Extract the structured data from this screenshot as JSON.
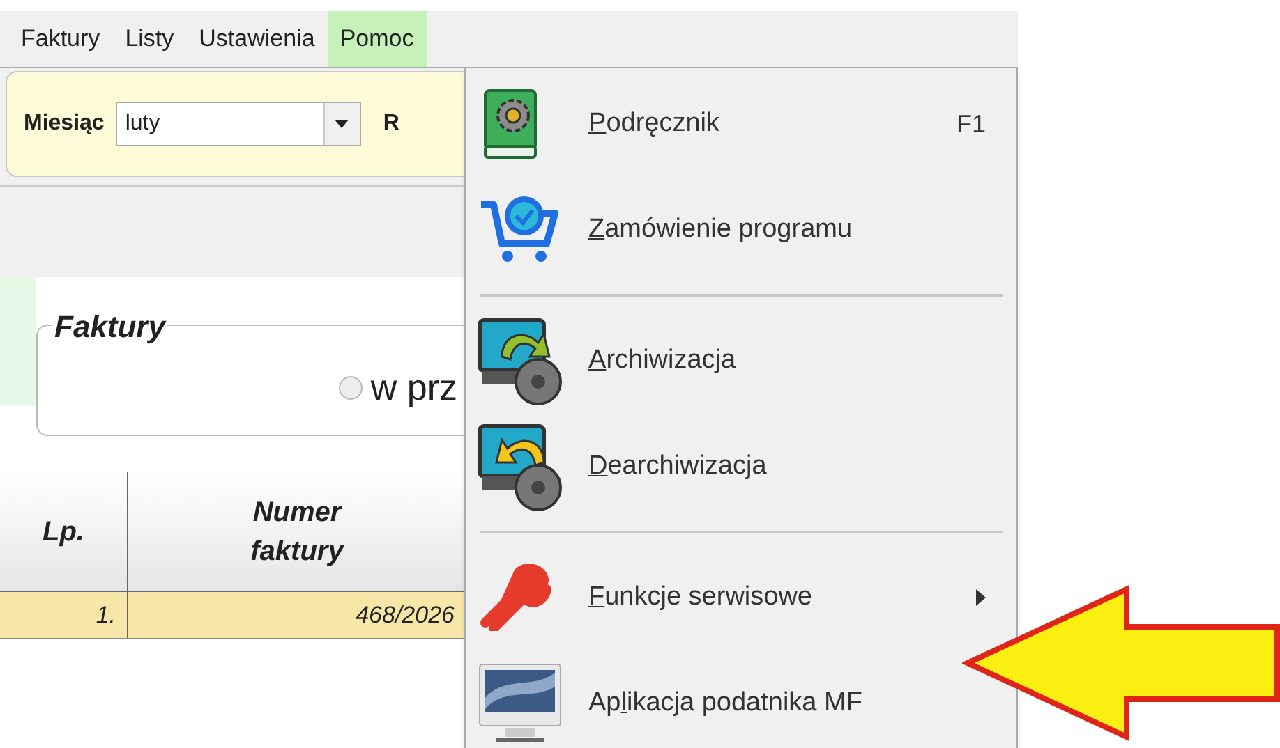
{
  "menubar": [
    {
      "label": "Faktury",
      "selected": false
    },
    {
      "label": "Listy",
      "selected": false
    },
    {
      "label": "Ustawienia",
      "selected": false
    },
    {
      "label": "Pomoc",
      "selected": true
    }
  ],
  "toolbar": {
    "month_label": "Miesiąc",
    "month_value": "luty",
    "next_label": "R"
  },
  "invoices_group": {
    "title": "Faktury",
    "radio_label": "w prz",
    "radio_checked": false
  },
  "table": {
    "columns": [
      "Lp.",
      "Numer faktury"
    ],
    "rows": [
      {
        "cells": [
          "1.",
          "468/2026"
        ],
        "selected": true
      }
    ]
  },
  "help_menu": [
    {
      "kind": "item",
      "key": "P",
      "post": "odręcznik",
      "shortcut": "F1"
    },
    {
      "kind": "item",
      "key": "Z",
      "post": "amówienie programu"
    },
    {
      "kind": "separator"
    },
    {
      "kind": "item",
      "key": "A",
      "post": "rchiwizacja"
    },
    {
      "kind": "item",
      "key": "D",
      "post": "earchiwizacja"
    },
    {
      "kind": "separator"
    },
    {
      "kind": "submenu",
      "key": "F",
      "post": "unkcje serwisowe"
    },
    {
      "kind": "item",
      "pre": "Ap",
      "key": "l",
      "post": "ikacja podatnika MF"
    }
  ]
}
